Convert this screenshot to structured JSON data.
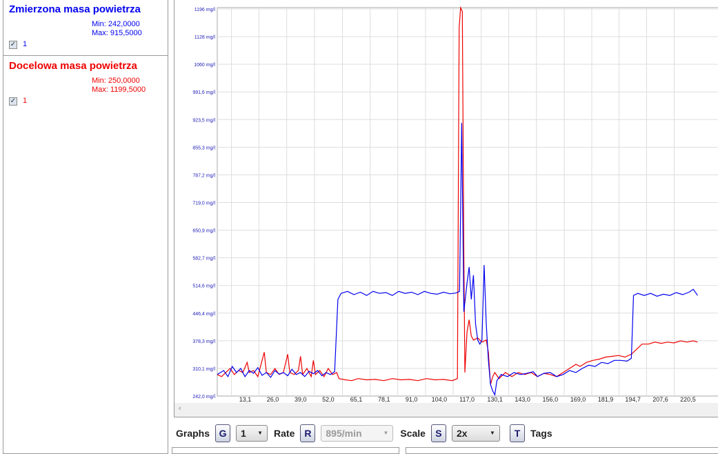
{
  "signals": [
    {
      "name": "Zmierzona masa powietrza",
      "min": "Min: 242,0000",
      "max": "Max: 915,5000",
      "channel": "1",
      "color": "#0000ee",
      "checked": true
    },
    {
      "name": "Docelowa masa powietrza",
      "min": "Min: 250,0000",
      "max": "Max: 1199,5000",
      "channel": "1",
      "color": "#ee0000",
      "checked": true
    }
  ],
  "toolbar": {
    "graphs_label": "Graphs",
    "graphs_key": "G",
    "graphs_value": "1",
    "rate_label": "Rate",
    "rate_key": "R",
    "rate_value": "895/min",
    "scale_label": "Scale",
    "scale_key": "S",
    "scale_value": "2x",
    "tags_key": "T",
    "tags_label": "Tags"
  },
  "scroll_left_arrow": "‹",
  "chart_data": {
    "type": "line",
    "ylim": [
      242,
      1196
    ],
    "xlim": [
      0,
      234
    ],
    "y_ticks": [
      "1196 mg/l",
      "1128 mg/l",
      "1060 mg/l",
      "991,6 mg/l",
      "923,5 mg/l",
      "855,3 mg/l",
      "787,2 mg/l",
      "719,0 mg/l",
      "650,9 mg/l",
      "582,7 mg/l",
      "514,6 mg/l",
      "446,4 mg/l",
      "378,3 mg/l",
      "310,1 mg/l",
      "242,0 mg/l"
    ],
    "x_ticks": [
      "13,1",
      "26,0",
      "39,0",
      "52,0",
      "65,1",
      "78,1",
      "91,0",
      "104,0",
      "117,0",
      "130,1",
      "143,0",
      "156,0",
      "169,0",
      "181,9",
      "194,7",
      "207,6",
      "220,5"
    ],
    "series": [
      {
        "name": "Zmierzona masa powietrza",
        "color": "#0000ee",
        "points": [
          [
            0,
            295
          ],
          [
            3,
            305
          ],
          [
            5,
            290
          ],
          [
            7,
            315
          ],
          [
            9,
            300
          ],
          [
            11,
            310
          ],
          [
            13,
            290
          ],
          [
            15,
            305
          ],
          [
            17,
            298
          ],
          [
            19,
            312
          ],
          [
            21,
            293
          ],
          [
            23,
            300
          ],
          [
            25,
            288
          ],
          [
            27,
            305
          ],
          [
            29,
            296
          ],
          [
            31,
            300
          ],
          [
            33,
            292
          ],
          [
            35,
            308
          ],
          [
            37,
            295
          ],
          [
            39,
            300
          ],
          [
            41,
            290
          ],
          [
            43,
            303
          ],
          [
            45,
            297
          ],
          [
            47,
            305
          ],
          [
            49,
            292
          ],
          [
            51,
            300
          ],
          [
            53,
            295
          ],
          [
            55,
            302
          ],
          [
            56.5,
            480
          ],
          [
            58,
            495
          ],
          [
            61,
            500
          ],
          [
            64,
            492
          ],
          [
            67,
            498
          ],
          [
            70,
            490
          ],
          [
            73,
            500
          ],
          [
            76,
            495
          ],
          [
            79,
            497
          ],
          [
            82,
            490
          ],
          [
            85,
            500
          ],
          [
            88,
            495
          ],
          [
            91,
            498
          ],
          [
            94,
            492
          ],
          [
            97,
            500
          ],
          [
            100,
            495
          ],
          [
            103,
            493
          ],
          [
            106,
            498
          ],
          [
            109,
            494
          ],
          [
            112,
            496
          ],
          [
            113.5,
            500
          ],
          [
            114.5,
            915
          ],
          [
            115.5,
            450
          ],
          [
            117,
            520
          ],
          [
            118,
            560
          ],
          [
            119,
            480
          ],
          [
            120,
            540
          ],
          [
            121,
            420
          ],
          [
            122,
            380
          ],
          [
            123,
            370
          ],
          [
            124,
            380
          ],
          [
            125,
            565
          ],
          [
            126,
            420
          ],
          [
            127,
            330
          ],
          [
            128,
            270
          ],
          [
            129,
            255
          ],
          [
            130,
            245
          ],
          [
            131,
            280
          ],
          [
            133,
            295
          ],
          [
            136,
            290
          ],
          [
            139,
            300
          ],
          [
            142,
            295
          ],
          [
            145,
            298
          ],
          [
            148,
            302
          ],
          [
            150,
            290
          ],
          [
            153,
            298
          ],
          [
            156,
            300
          ],
          [
            159,
            290
          ],
          [
            162,
            295
          ],
          [
            165,
            305
          ],
          [
            168,
            300
          ],
          [
            171,
            310
          ],
          [
            174,
            318
          ],
          [
            177,
            315
          ],
          [
            180,
            325
          ],
          [
            183,
            322
          ],
          [
            186,
            330
          ],
          [
            189,
            330
          ],
          [
            192,
            328
          ],
          [
            194,
            335
          ],
          [
            195,
            490
          ],
          [
            197,
            495
          ],
          [
            200,
            490
          ],
          [
            203,
            495
          ],
          [
            206,
            488
          ],
          [
            209,
            493
          ],
          [
            212,
            490
          ],
          [
            215,
            497
          ],
          [
            218,
            492
          ],
          [
            221,
            498
          ],
          [
            223,
            505
          ],
          [
            225,
            490
          ]
        ]
      },
      {
        "name": "Docelowa masa powietrza",
        "color": "#ee0000",
        "points": [
          [
            0,
            295
          ],
          [
            2,
            290
          ],
          [
            4,
            300
          ],
          [
            6,
            310
          ],
          [
            8,
            295
          ],
          [
            10,
            305
          ],
          [
            12,
            300
          ],
          [
            14,
            325
          ],
          [
            15,
            300
          ],
          [
            17,
            305
          ],
          [
            19,
            290
          ],
          [
            21,
            330
          ],
          [
            22,
            350
          ],
          [
            23,
            300
          ],
          [
            25,
            295
          ],
          [
            27,
            310
          ],
          [
            29,
            295
          ],
          [
            31,
            300
          ],
          [
            33,
            345
          ],
          [
            34,
            300
          ],
          [
            36,
            295
          ],
          [
            38,
            305
          ],
          [
            39,
            340
          ],
          [
            40,
            295
          ],
          [
            42,
            310
          ],
          [
            44,
            290
          ],
          [
            45,
            330
          ],
          [
            46,
            295
          ],
          [
            48,
            305
          ],
          [
            50,
            290
          ],
          [
            52,
            310
          ],
          [
            54,
            295
          ],
          [
            56,
            300
          ],
          [
            57,
            285
          ],
          [
            60,
            282
          ],
          [
            63,
            280
          ],
          [
            66,
            285
          ],
          [
            70,
            282
          ],
          [
            74,
            283
          ],
          [
            78,
            280
          ],
          [
            82,
            285
          ],
          [
            86,
            282
          ],
          [
            90,
            283
          ],
          [
            94,
            280
          ],
          [
            98,
            285
          ],
          [
            102,
            282
          ],
          [
            106,
            283
          ],
          [
            110,
            280
          ],
          [
            112.5,
            285
          ],
          [
            113.3,
            1150
          ],
          [
            114,
            1199
          ],
          [
            114.8,
            1190
          ],
          [
            115.5,
            600
          ],
          [
            116,
            300
          ],
          [
            117,
            400
          ],
          [
            118,
            430
          ],
          [
            119,
            390
          ],
          [
            120,
            380
          ],
          [
            122,
            385
          ],
          [
            124,
            375
          ],
          [
            126,
            380
          ],
          [
            127,
            350
          ],
          [
            128,
            270
          ],
          [
            129,
            290
          ],
          [
            130,
            300
          ],
          [
            132,
            285
          ],
          [
            135,
            300
          ],
          [
            138,
            290
          ],
          [
            141,
            300
          ],
          [
            144,
            295
          ],
          [
            147,
            300
          ],
          [
            150,
            290
          ],
          [
            153,
            298
          ],
          [
            156,
            295
          ],
          [
            159,
            290
          ],
          [
            162,
            300
          ],
          [
            165,
            310
          ],
          [
            168,
            320
          ],
          [
            170,
            315
          ],
          [
            173,
            325
          ],
          [
            176,
            330
          ],
          [
            179,
            333
          ],
          [
            182,
            338
          ],
          [
            185,
            340
          ],
          [
            188,
            342
          ],
          [
            191,
            338
          ],
          [
            194,
            345
          ],
          [
            197,
            360
          ],
          [
            199,
            370
          ],
          [
            202,
            370
          ],
          [
            205,
            375
          ],
          [
            208,
            372
          ],
          [
            211,
            375
          ],
          [
            214,
            373
          ],
          [
            217,
            378
          ],
          [
            220,
            375
          ],
          [
            223,
            378
          ],
          [
            225,
            375
          ]
        ]
      }
    ]
  }
}
